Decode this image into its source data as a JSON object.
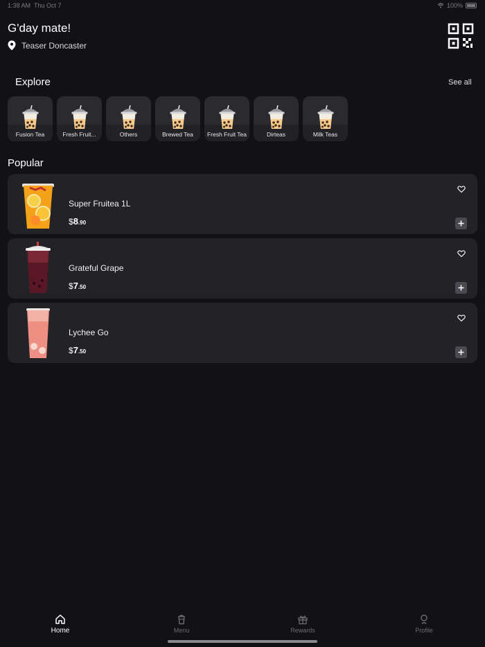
{
  "status": {
    "time": "1:38 AM",
    "date": "Thu Oct 7",
    "battery": "100%"
  },
  "header": {
    "greeting": "G'day mate!",
    "location": "Teaser Doncaster",
    "qr_icon": "qr-code-icon"
  },
  "explore": {
    "title": "Explore",
    "see_all": "See all",
    "categories": [
      {
        "label": "Fusion Tea"
      },
      {
        "label": "Fresh Fruit..."
      },
      {
        "label": "Others"
      },
      {
        "label": "Brewed Tea"
      },
      {
        "label": "Fresh Fruit Tea"
      },
      {
        "label": "Dirteas"
      },
      {
        "label": "Milk Teas"
      }
    ]
  },
  "popular": {
    "title": "Popular",
    "items": [
      {
        "name": "Super Fruitea 1L",
        "currency": "$",
        "whole": "8",
        "cents": ".90"
      },
      {
        "name": "Grateful Grape",
        "currency": "$",
        "whole": "7",
        "cents": ".50"
      },
      {
        "name": "Lychee Go",
        "currency": "$",
        "whole": "7",
        "cents": ".50"
      }
    ]
  },
  "tabs": [
    {
      "label": "Home",
      "icon": "home-icon",
      "active": true
    },
    {
      "label": "Menu",
      "icon": "cup-icon",
      "active": false
    },
    {
      "label": "Rewards",
      "icon": "gift-icon",
      "active": false
    },
    {
      "label": "Profile",
      "icon": "profile-icon",
      "active": false
    }
  ],
  "colors": {
    "background": "#121216",
    "card": "#232327",
    "tile": "#2a2a2f",
    "active_tab": "#ffffff",
    "inactive_tab": "#6a6a70"
  }
}
